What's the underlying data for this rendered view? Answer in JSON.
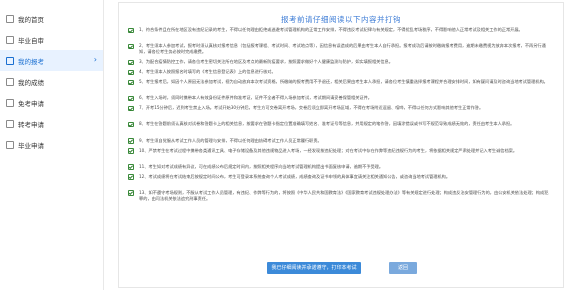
{
  "sidebar": {
    "items": [
      {
        "label": "我的首页",
        "icon": "home-icon",
        "active": false
      },
      {
        "label": "毕业自审",
        "icon": "audit-icon",
        "active": false
      },
      {
        "label": "我的报考",
        "icon": "apply-icon",
        "active": true
      },
      {
        "label": "我的成绩",
        "icon": "score-icon",
        "active": false
      },
      {
        "label": "免考申请",
        "icon": "exempt-icon",
        "active": false
      },
      {
        "label": "转考申请",
        "icon": "transfer-icon",
        "active": false
      },
      {
        "label": "毕业申请",
        "icon": "graduation-icon",
        "active": false
      }
    ],
    "chevron": "›"
  },
  "notice": {
    "title": "报考前请仔细阅读以下内容并打钩",
    "items": [
      "1、符合条件且在所在地区没有违纪记录的考生，不得以任何理由拒绝或逃避考试管理机构的正常工作安排，不得违反考试纪律与有关规定，不得扰乱考场秩序，不得影响他人正常考试及相关工作的正常开展。",
      "2、考生须本人参加考试，报考时须认真核对报考信息（包括报考课程、考试时间、考试地点等），因信息有误造成的后果由考生本人自行承担。报考成功后请按时缴纳报考费用，逾期未缴费视为放弃本次报考，不再另行通知，请各位考生务必按时完成缴费。",
      "3、为配合疫情防控工作，请各位考生密切关注所在地区及考点的最新防疫要求，按照要求做好个人健康监测与防护，如实填报相关信息。",
      "4、考生须本人按照报名时填写的《考生信息登记表》上的信息进行核对。",
      "5、考生报考后，如因个人原因无法参加考试，视为自动放弃本次考试资格，所缴纳的报考费用不予退还，相关后果由考生本人承担，请各位考生慎重选择报考课程并合理安排时间，如有疑问请及时咨询当地考试管理机构。",
      "6、考生入场时，须同时携带本人有效身份证件原件和准考证，证件不全者不得入场参加考试，考试期间请妥善保管相关证件。",
      "7、开考15分钟后，迟到考生禁止入场。考试开始30分钟后，考生方可交卷离开考场，交卷后须立即离开考场区域，不得在考场附近逗留、喧哗，不得以任何方式影响其他考生正常作答。",
      "8、考生在答题前须认真核对试卷和答题卡上的相关信息，按要求在答题卡指定位置准确填写姓名、准考证号等信息，并用规定的笔作答，因填涂错误或书写不规范导致成绩无效的，责任由考生本人承担。",
      "9、考生须自觉服从考试工作人员的管理与安排，不得以任何理由妨碍考试工作人员正常履行职责。",
      "10、严禁考生在考试过程中携带各类通讯工具、电子存储设备及其他违规物品进入考场，一经发现按违纪处理；对在考试中存在作弊等违纪违规行为的考生，将依据相关规定严肃处理并记入考生诚信档案。",
      "11、考生如对考试成绩有异议，可在成绩公布后规定时间内，按照相关程序向当地考试管理机构提出书面复核申请，逾期不予受理。",
      "12、考试成绩将在考试结束后按规定时间公布，考生可登录本系统查询个人考试成绩，成绩查询及证书申领的具体事宜请关注相关通知公告，或咨询当地考试管理机构。",
      "13、如不遵守考场规则，不服从考试工作人员管理，有违纪、作弊等行为的，将按照《中华人民共和国教育法》《国家教育考试违规处理办法》等有关规定进行处理；构成违反治安管理行为的，由公安机关依法处理；构成犯罪的，由司法机关依法追究刑事责任。"
    ],
    "line_counts": [
      2,
      2,
      1,
      1,
      2,
      1,
      2,
      2,
      1,
      2,
      1,
      2,
      3
    ]
  },
  "buttons": {
    "confirm": "我已仔细阅读并承诺遵守，打印本考试",
    "back": "返回"
  },
  "colors": {
    "accent": "#3c8ad9",
    "title": "#3d7cd6",
    "active_nav_bg": "#e8f2ff",
    "checkbox": "#3a8a3a"
  }
}
